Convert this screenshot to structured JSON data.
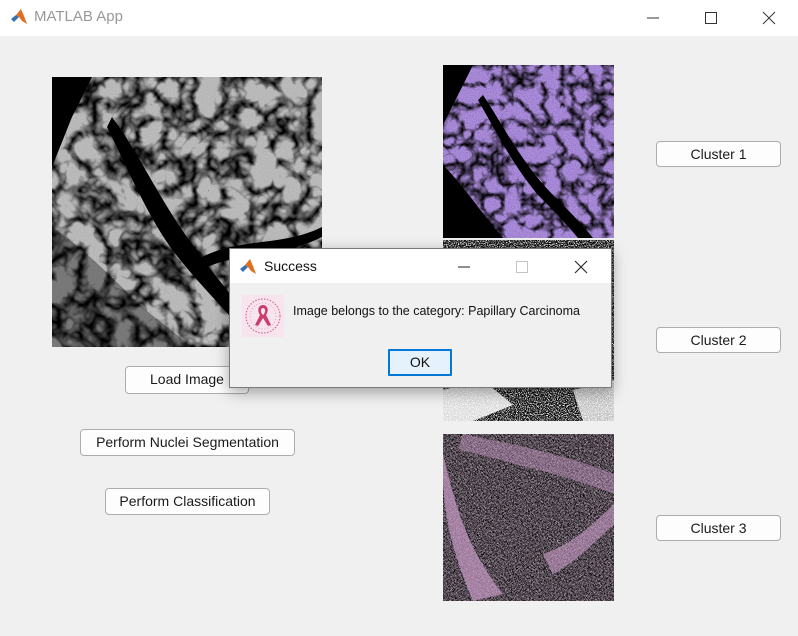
{
  "window": {
    "title": "MATLAB App",
    "icon": "matlab-logo-icon",
    "controls": [
      "minimize-icon",
      "maximize-icon",
      "close-icon"
    ]
  },
  "main": {
    "buttons": {
      "load_image": "Load Image",
      "nuclei_segmentation": "Perform Nuclei Segmentation",
      "classification": "Perform Classification"
    }
  },
  "clusters": {
    "cluster1": "Cluster 1",
    "cluster2": "Cluster 2",
    "cluster3": "Cluster 3"
  },
  "dialog": {
    "title": "Success",
    "icon": "pink-ribbon-icon",
    "message": "Image belongs to the category: Papillary Carcinoma",
    "ok_label": "OK"
  },
  "colors": {
    "background": "#f0f0f0",
    "titlebar": "#ffffff",
    "cluster1_tint": "#8e6bc9",
    "cluster3_tint": "#c99bc8",
    "ok_border": "#0078d7"
  }
}
